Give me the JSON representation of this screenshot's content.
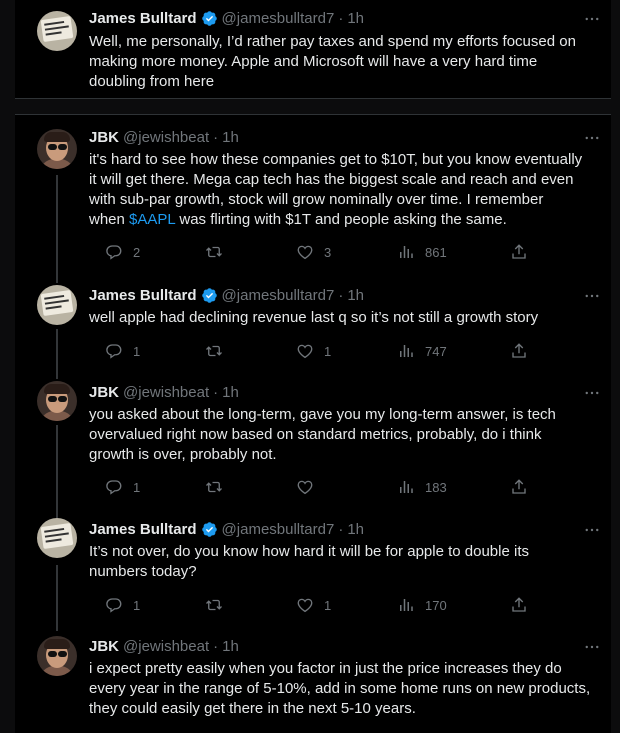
{
  "tweets": [
    {
      "name": "James Bulltard",
      "verified": true,
      "handle": "@jamesbulltard7",
      "dot": "·",
      "time": "1h",
      "text": "Well, me personally, I’d rather pay taxes and spend my efforts focused on\nmaking more money. Apple and Microsoft will have a very hard time\ndoubling from here",
      "avatar": "placard"
    },
    {
      "name": "JBK",
      "verified": false,
      "handle": "@jewishbeat",
      "dot": "·",
      "time": "1h",
      "text_parts": {
        "before": "it's hard to see how these companies get to $10T, but you know eventually\nit will get there. Mega cap tech has the biggest scale and reach and even\nwith sub-par growth, stock will grow nominally over time. I remember\nwhen ",
        "cashtag": "$AAPL",
        "after": " was flirting with $1T and people asking the same."
      },
      "replies": "2",
      "retweets": "",
      "likes": "3",
      "views": "861",
      "avatar": "face"
    },
    {
      "name": "James Bulltard",
      "verified": true,
      "handle": "@jamesbulltard7",
      "dot": "·",
      "time": "1h",
      "text": "well apple had declining revenue last q so it’s not still a growth story",
      "replies": "1",
      "retweets": "",
      "likes": "1",
      "views": "747",
      "avatar": "placard"
    },
    {
      "name": "JBK",
      "verified": false,
      "handle": "@jewishbeat",
      "dot": "·",
      "time": "1h",
      "text": "you asked about the long-term, gave you my long-term answer, is tech\novervalued right now based on standard metrics, probably, do i think\ngrowth is over, probably not.",
      "replies": "1",
      "retweets": "",
      "likes": "",
      "views": "183",
      "avatar": "face"
    },
    {
      "name": "James Bulltard",
      "verified": true,
      "handle": "@jamesbulltard7",
      "dot": "·",
      "time": "1h",
      "text": "It’s not over, do you know how hard it will be for apple to double its\nnumbers today?",
      "replies": "1",
      "retweets": "",
      "likes": "1",
      "views": "170",
      "avatar": "placard"
    },
    {
      "name": "JBK",
      "verified": false,
      "handle": "@jewishbeat",
      "dot": "·",
      "time": "1h",
      "text": "i expect pretty easily when you factor in just the price increases they do\nevery year in the range of 5-10%, add in some home runs on new products,\nthey could easily get there in the next 5-10 years.",
      "avatar": "face"
    }
  ],
  "colors": {
    "background": "#000000",
    "text": "#e7e9ea",
    "muted": "#71767b",
    "accent": "#1d9bf0",
    "divider": "#2f3336"
  },
  "icons": [
    "verified-badge-icon",
    "more-icon",
    "reply-icon",
    "retweet-icon",
    "like-icon",
    "views-icon",
    "share-icon"
  ]
}
